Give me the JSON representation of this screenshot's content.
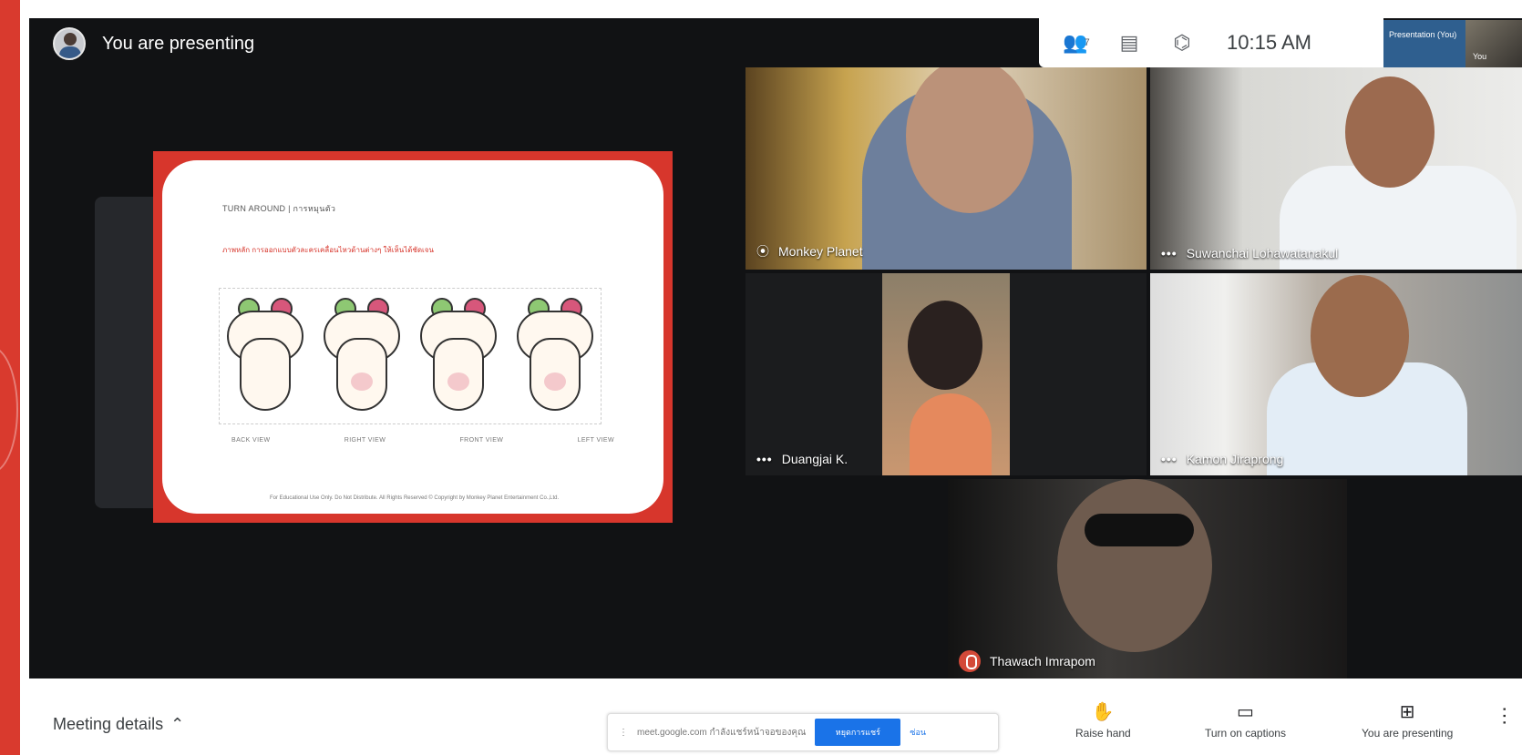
{
  "header": {
    "presenting_text": "You are presenting",
    "time": "10:15 AM",
    "people_badge": "7",
    "self_view_presentation": "Presentation (You)",
    "self_view_name": "You"
  },
  "slide": {
    "title": "TURN AROUND | การหมุนตัว",
    "subtitle": "ภาพหลัก การออกแบบตัวละครเคลื่อนไหวด้านต่างๆ ให้เห็นได้ชัดเจน",
    "views": [
      "BACK VIEW",
      "RIGHT VIEW",
      "FRONT VIEW",
      "LEFT VIEW"
    ],
    "footer": "For Educational Use Only. Do Not Distribute. All Rights Reserved © Copyright by Monkey Planet Entertainment Co.,Ltd."
  },
  "participants": [
    {
      "name": "Monkey Planet"
    },
    {
      "name": "Suwanchai Lohawatanakul"
    },
    {
      "name": "Duangjai K."
    },
    {
      "name": "Kamon Jiraprong"
    },
    {
      "name": "Thawach Imrapom"
    }
  ],
  "bottom": {
    "meeting_details": "Meeting details",
    "banner_text": "meet.google.com กำลังแชร์หน้าจอของคุณ",
    "banner_button": "หยุดการแชร์",
    "banner_dismiss": "ซ่อน",
    "raise_hand": "Raise hand",
    "captions": "Turn on captions",
    "present": "You are presenting"
  },
  "icons": {
    "people": "people-icon",
    "chat": "chat-icon",
    "activities": "activities-icon",
    "raise": "raise-hand-icon",
    "captions": "captions-icon",
    "present": "present-icon",
    "more": "more-options-icon"
  }
}
